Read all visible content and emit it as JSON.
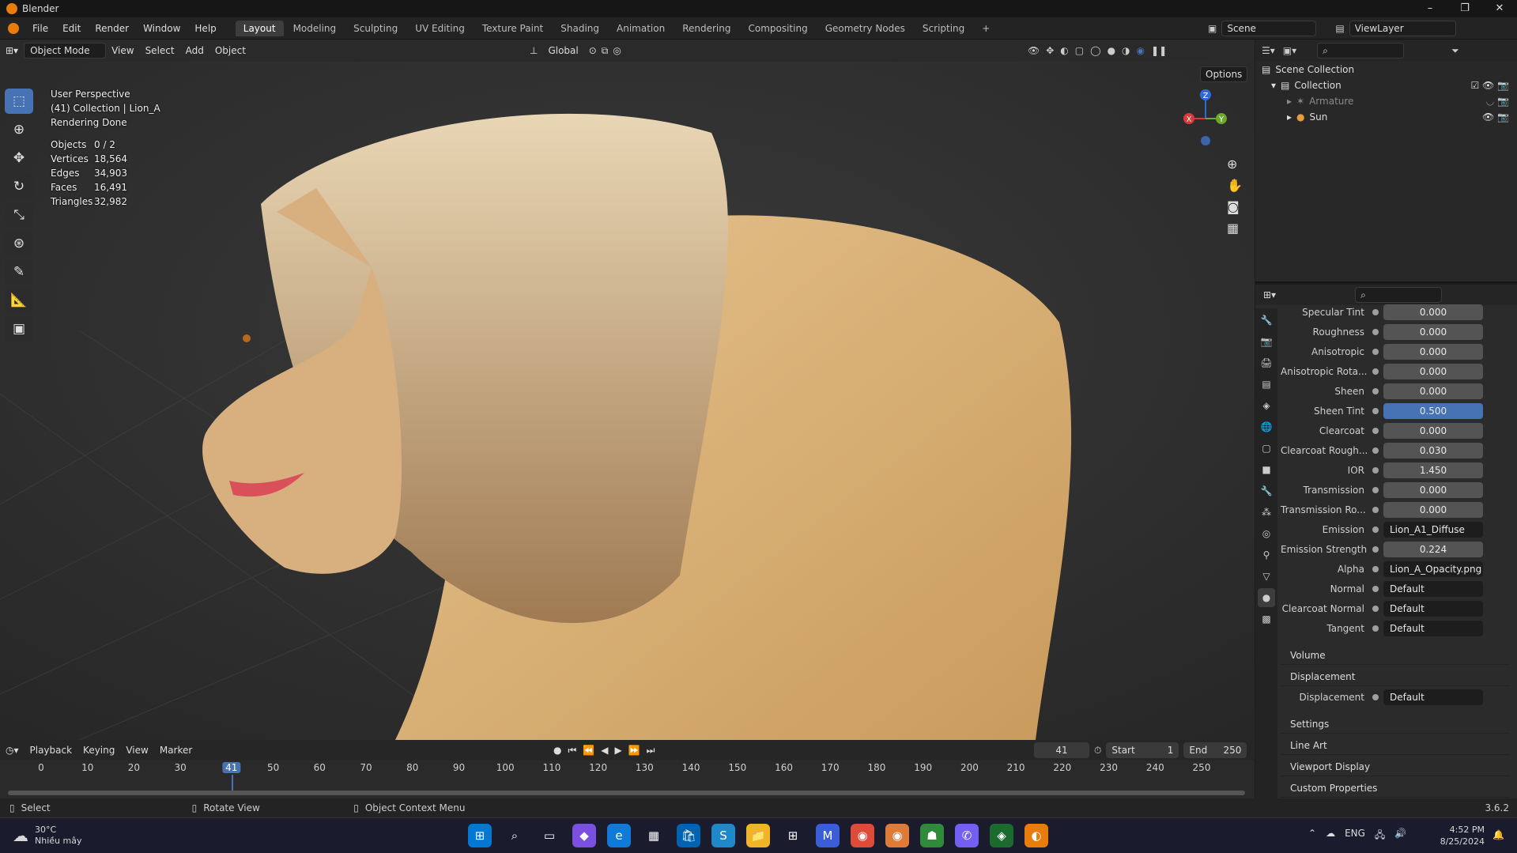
{
  "window": {
    "title": "Blender",
    "minimize": "–",
    "maximize": "❐",
    "close": "✕"
  },
  "menubar": {
    "items": [
      "File",
      "Edit",
      "Render",
      "Window",
      "Help"
    ]
  },
  "workspaces": [
    "Layout",
    "Modeling",
    "Sculpting",
    "UV Editing",
    "Texture Paint",
    "Shading",
    "Animation",
    "Rendering",
    "Compositing",
    "Geometry Nodes",
    "Scripting"
  ],
  "add_workspace": "+",
  "scene": {
    "name": "Scene",
    "viewlayer": "ViewLayer"
  },
  "viewport_header": {
    "mode": "Object Mode",
    "view": "View",
    "select": "Select",
    "add": "Add",
    "object": "Object",
    "orientation": "Global",
    "options": "Options"
  },
  "overlay": {
    "line1": "User Perspective",
    "line2": "(41) Collection | Lion_A",
    "line3": "Rendering Done",
    "stats": [
      {
        "k": "Objects",
        "v": "0 / 2"
      },
      {
        "k": "Vertices",
        "v": "18,564"
      },
      {
        "k": "Edges",
        "v": "34,903"
      },
      {
        "k": "Faces",
        "v": "16,491"
      },
      {
        "k": "Triangles",
        "v": "32,982"
      }
    ]
  },
  "gizmo": {
    "z": "Z",
    "y": "Y",
    "x": "X"
  },
  "outliner": {
    "scene_collection": "Scene Collection",
    "collection": "Collection",
    "items": [
      "Armature",
      "Sun"
    ]
  },
  "properties": {
    "rows": [
      {
        "label": "Specular Tint",
        "value": "0.000"
      },
      {
        "label": "Roughness",
        "value": "0.000"
      },
      {
        "label": "Anisotropic",
        "value": "0.000"
      },
      {
        "label": "Anisotropic Rota...",
        "value": "0.000"
      },
      {
        "label": "Sheen",
        "value": "0.000"
      },
      {
        "label": "Sheen Tint",
        "value": "0.500"
      },
      {
        "label": "Clearcoat",
        "value": "0.000"
      },
      {
        "label": "Clearcoat Rough...",
        "value": "0.030"
      },
      {
        "label": "IOR",
        "value": "1.450"
      },
      {
        "label": "Transmission",
        "value": "0.000"
      },
      {
        "label": "Transmission Ro...",
        "value": "0.000"
      },
      {
        "label": "Emission",
        "value": "Lion_A1_Diffuse"
      },
      {
        "label": "Emission Strength",
        "value": "0.224"
      },
      {
        "label": "Alpha",
        "value": "Lion_A_Opacity.png"
      },
      {
        "label": "Normal",
        "value": "Default"
      },
      {
        "label": "Clearcoat Normal",
        "value": "Default"
      },
      {
        "label": "Tangent",
        "value": "Default"
      }
    ],
    "sections": [
      "Volume",
      "Displacement"
    ],
    "displacement": {
      "label": "Displacement",
      "value": "Default"
    },
    "sections2": [
      "Settings",
      "Line Art",
      "Viewport Display",
      "Custom Properties"
    ]
  },
  "timeline": {
    "menus": [
      "Playback",
      "Keying",
      "View",
      "Marker"
    ],
    "current": "41",
    "start_label": "Start",
    "start": "1",
    "end_label": "End",
    "end": "250",
    "ticks": [
      "0",
      "10",
      "20",
      "30",
      "41",
      "50",
      "60",
      "70",
      "80",
      "90",
      "100",
      "110",
      "120",
      "130",
      "140",
      "150",
      "160",
      "170",
      "180",
      "190",
      "200",
      "210",
      "220",
      "230",
      "240",
      "250"
    ]
  },
  "statusbar": {
    "select": "Select",
    "rotate": "Rotate View",
    "context": "Object Context Menu",
    "version": "3.6.2"
  },
  "taskbar": {
    "temp": "30°C",
    "weather": "Nhiều mây",
    "lang": "ENG",
    "time": "4:52 PM",
    "date": "8/25/2024"
  }
}
